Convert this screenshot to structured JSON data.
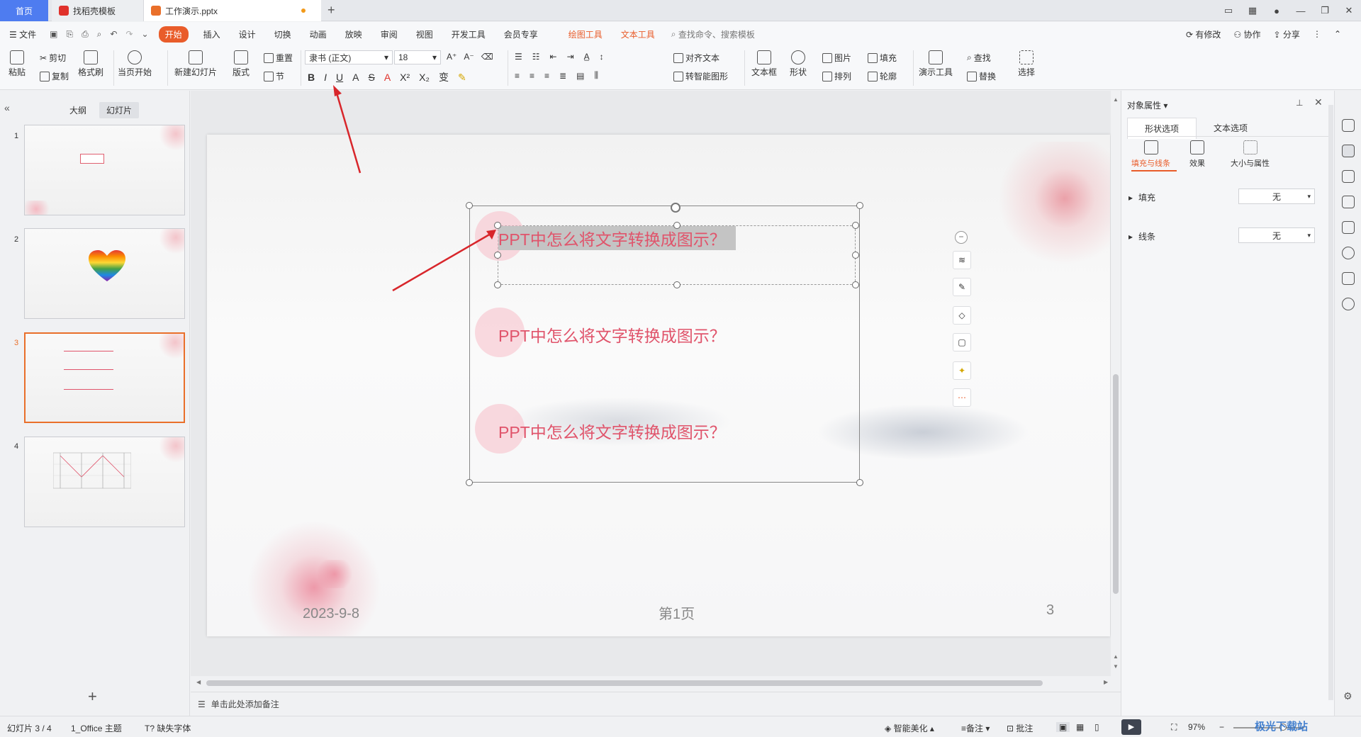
{
  "titlebar": {
    "home_tab": "首页",
    "tab2": "找稻壳模板",
    "tab3": "工作演示.pptx",
    "new_tab": "+"
  },
  "menubar": {
    "file": "文件",
    "items": [
      "开始",
      "插入",
      "设计",
      "切换",
      "动画",
      "放映",
      "审阅",
      "视图",
      "开发工具",
      "会员专享"
    ],
    "tools": [
      "绘图工具",
      "文本工具"
    ],
    "search_placeholder": "查找命令、搜索模板",
    "right": [
      "有修改",
      "协作",
      "分享"
    ]
  },
  "ribbon": {
    "paste": "粘贴",
    "cut": "剪切",
    "copy": "复制",
    "format_painter": "格式刷",
    "from_current": "当页开始",
    "new_slide": "新建幻灯片",
    "layout": "版式",
    "reset": "重置",
    "section": "节",
    "font_name": "隶书 (正文)",
    "font_size": "18",
    "align_text": "对齐文本",
    "smartart": "转智能图形",
    "textbox": "文本框",
    "shape": "形状",
    "picture": "图片",
    "arrange": "排列",
    "fill": "填充",
    "outline": "轮廓",
    "present_tools": "演示工具",
    "find": "查找",
    "replace": "替换",
    "select": "选择"
  },
  "leftpanel": {
    "tab_outline": "大纲",
    "tab_slides": "幻灯片",
    "thumb_numbers": [
      "1",
      "2",
      "3",
      "4"
    ],
    "add": "+"
  },
  "slide": {
    "items": [
      "PPT中怎么将文字转换成图示？",
      "PPT中怎么将文字转换成图示？",
      "PPT中怎么将文字转换成图示？"
    ],
    "footer_date": "2023-9-8",
    "footer_page": "第1页",
    "footer_num": "3"
  },
  "notes": {
    "placeholder": "单击此处添加备注"
  },
  "rightpane": {
    "title": "对象属性",
    "tab_shape": "形状选项",
    "tab_text": "文本选项",
    "sub_fill": "填充与线条",
    "sub_effect": "效果",
    "sub_size": "大小与属性",
    "row_fill": "填充",
    "row_line": "线条",
    "fill_value": "无",
    "line_value": "无"
  },
  "statusbar": {
    "slide_count": "幻灯片 3 / 4",
    "theme": "1_Office 主题",
    "missing_font": "缺失字体",
    "beautify": "智能美化",
    "notes": "备注",
    "comment": "批注",
    "zoom": "97%",
    "watermark": "极光下载站"
  },
  "colors": {
    "accent": "#e95c2a",
    "home_tab": "#4e7cf0",
    "slide_text": "#e0546b"
  }
}
